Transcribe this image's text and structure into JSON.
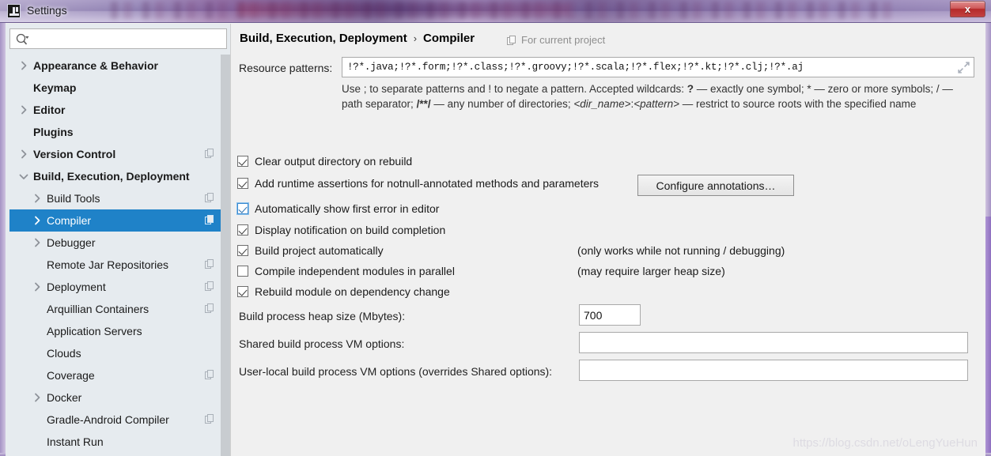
{
  "window": {
    "title": "Settings",
    "app_icon": "intellij-idea-icon",
    "close_label": "x"
  },
  "sidebar": {
    "search": {
      "placeholder": "",
      "value": "",
      "icon": "search-icon"
    },
    "items": [
      {
        "label": "Appearance & Behavior",
        "level": 0,
        "bold": true,
        "twisty": "right",
        "copy": false,
        "selected": false
      },
      {
        "label": "Keymap",
        "level": 0,
        "bold": true,
        "twisty": "none",
        "copy": false,
        "selected": false
      },
      {
        "label": "Editor",
        "level": 0,
        "bold": true,
        "twisty": "right",
        "copy": false,
        "selected": false
      },
      {
        "label": "Plugins",
        "level": 0,
        "bold": true,
        "twisty": "none",
        "copy": false,
        "selected": false
      },
      {
        "label": "Version Control",
        "level": 0,
        "bold": true,
        "twisty": "right",
        "copy": true,
        "selected": false
      },
      {
        "label": "Build, Execution, Deployment",
        "level": 0,
        "bold": true,
        "twisty": "down",
        "copy": false,
        "selected": false
      },
      {
        "label": "Build Tools",
        "level": 1,
        "bold": false,
        "twisty": "right",
        "copy": true,
        "selected": false
      },
      {
        "label": "Compiler",
        "level": 1,
        "bold": false,
        "twisty": "right",
        "copy": true,
        "selected": true
      },
      {
        "label": "Debugger",
        "level": 1,
        "bold": false,
        "twisty": "right",
        "copy": false,
        "selected": false
      },
      {
        "label": "Remote Jar Repositories",
        "level": 1,
        "bold": false,
        "twisty": "none",
        "copy": true,
        "selected": false
      },
      {
        "label": "Deployment",
        "level": 1,
        "bold": false,
        "twisty": "right",
        "copy": true,
        "selected": false
      },
      {
        "label": "Arquillian Containers",
        "level": 1,
        "bold": false,
        "twisty": "none",
        "copy": true,
        "selected": false
      },
      {
        "label": "Application Servers",
        "level": 1,
        "bold": false,
        "twisty": "none",
        "copy": false,
        "selected": false
      },
      {
        "label": "Clouds",
        "level": 1,
        "bold": false,
        "twisty": "none",
        "copy": false,
        "selected": false
      },
      {
        "label": "Coverage",
        "level": 1,
        "bold": false,
        "twisty": "none",
        "copy": true,
        "selected": false
      },
      {
        "label": "Docker",
        "level": 1,
        "bold": false,
        "twisty": "right",
        "copy": false,
        "selected": false
      },
      {
        "label": "Gradle-Android Compiler",
        "level": 1,
        "bold": false,
        "twisty": "none",
        "copy": true,
        "selected": false
      },
      {
        "label": "Instant Run",
        "level": 1,
        "bold": false,
        "twisty": "none",
        "copy": false,
        "selected": false
      }
    ],
    "selected_color": "#1f82c8",
    "background_color": "#e6ebef"
  },
  "main": {
    "breadcrumb": {
      "root": "Build, Execution, Deployment",
      "separator": "›",
      "current": "Compiler"
    },
    "scope_note": {
      "icon": "copy-icon",
      "text": "For current project"
    },
    "resource_patterns": {
      "label": "Resource patterns:",
      "value": "!?*.java;!?*.form;!?*.class;!?*.groovy;!?*.scala;!?*.flex;!?*.kt;!?*.clj;!?*.aj",
      "expand_icon": "expand-arrows-icon",
      "help_1": "Use ; to separate patterns and ! to negate a pattern. Accepted wildcards: ",
      "help_q": "?",
      "help_2": " — exactly one symbol; * — zero or more symbols; / — path separator; ",
      "help_dblstar": "/**/",
      "help_3": " — any number of directories; ",
      "help_dirname": "<dir_name>",
      "help_colon": ":",
      "help_pattern": "<pattern>",
      "help_4": " — restrict to source roots with the specified name"
    },
    "checkboxes": [
      {
        "label": "Clear output directory on rebuild",
        "checked": true,
        "focused": false,
        "hint": ""
      },
      {
        "label": "Add runtime assertions for notnull-annotated methods and parameters",
        "checked": true,
        "focused": false,
        "hint": ""
      },
      {
        "label": "Automatically show first error in editor",
        "checked": true,
        "focused": true,
        "hint": ""
      },
      {
        "label": "Display notification on build completion",
        "checked": true,
        "focused": false,
        "hint": ""
      },
      {
        "label": "Build project automatically",
        "checked": true,
        "focused": false,
        "hint": "(only works while not running / debugging)"
      },
      {
        "label": "Compile independent modules in parallel",
        "checked": false,
        "focused": false,
        "hint": "(may require larger heap size)"
      },
      {
        "label": "Rebuild module on dependency change",
        "checked": true,
        "focused": false,
        "hint": ""
      }
    ],
    "configure_annotations_button": "Configure annotations…",
    "fields": [
      {
        "label": "Build process heap size (Mbytes):",
        "value": "700",
        "placeholder": ""
      },
      {
        "label": "Shared build process VM options:",
        "value": "",
        "placeholder": ""
      },
      {
        "label": "User-local build process VM options (overrides Shared options):",
        "value": "",
        "placeholder": ""
      }
    ]
  },
  "watermark": "https://blog.csdn.net/oLengYueHun"
}
